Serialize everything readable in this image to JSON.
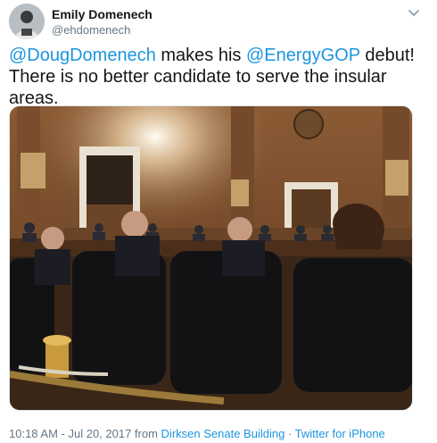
{
  "tweet": {
    "author_name": "Emily Domenech",
    "author_handle": "@ehdomenech",
    "text_parts": {
      "mention1": "@DougDomenech",
      "mid": " makes his ",
      "mention2": "@EnergyGOP",
      "end": " debut! There is no better candidate to serve the insular areas."
    },
    "timestamp": "10:18 AM - Jul 20, 2017",
    "from_label": " from ",
    "location": "Dirksen Senate Building",
    "separator": " · ",
    "source": "Twitter for iPhone"
  },
  "icons": {
    "avatar": "profile-photo",
    "menu": "chevron-down-icon"
  },
  "colors": {
    "link": "#1b95e0",
    "secondary": "#657786",
    "text": "#14171a"
  }
}
